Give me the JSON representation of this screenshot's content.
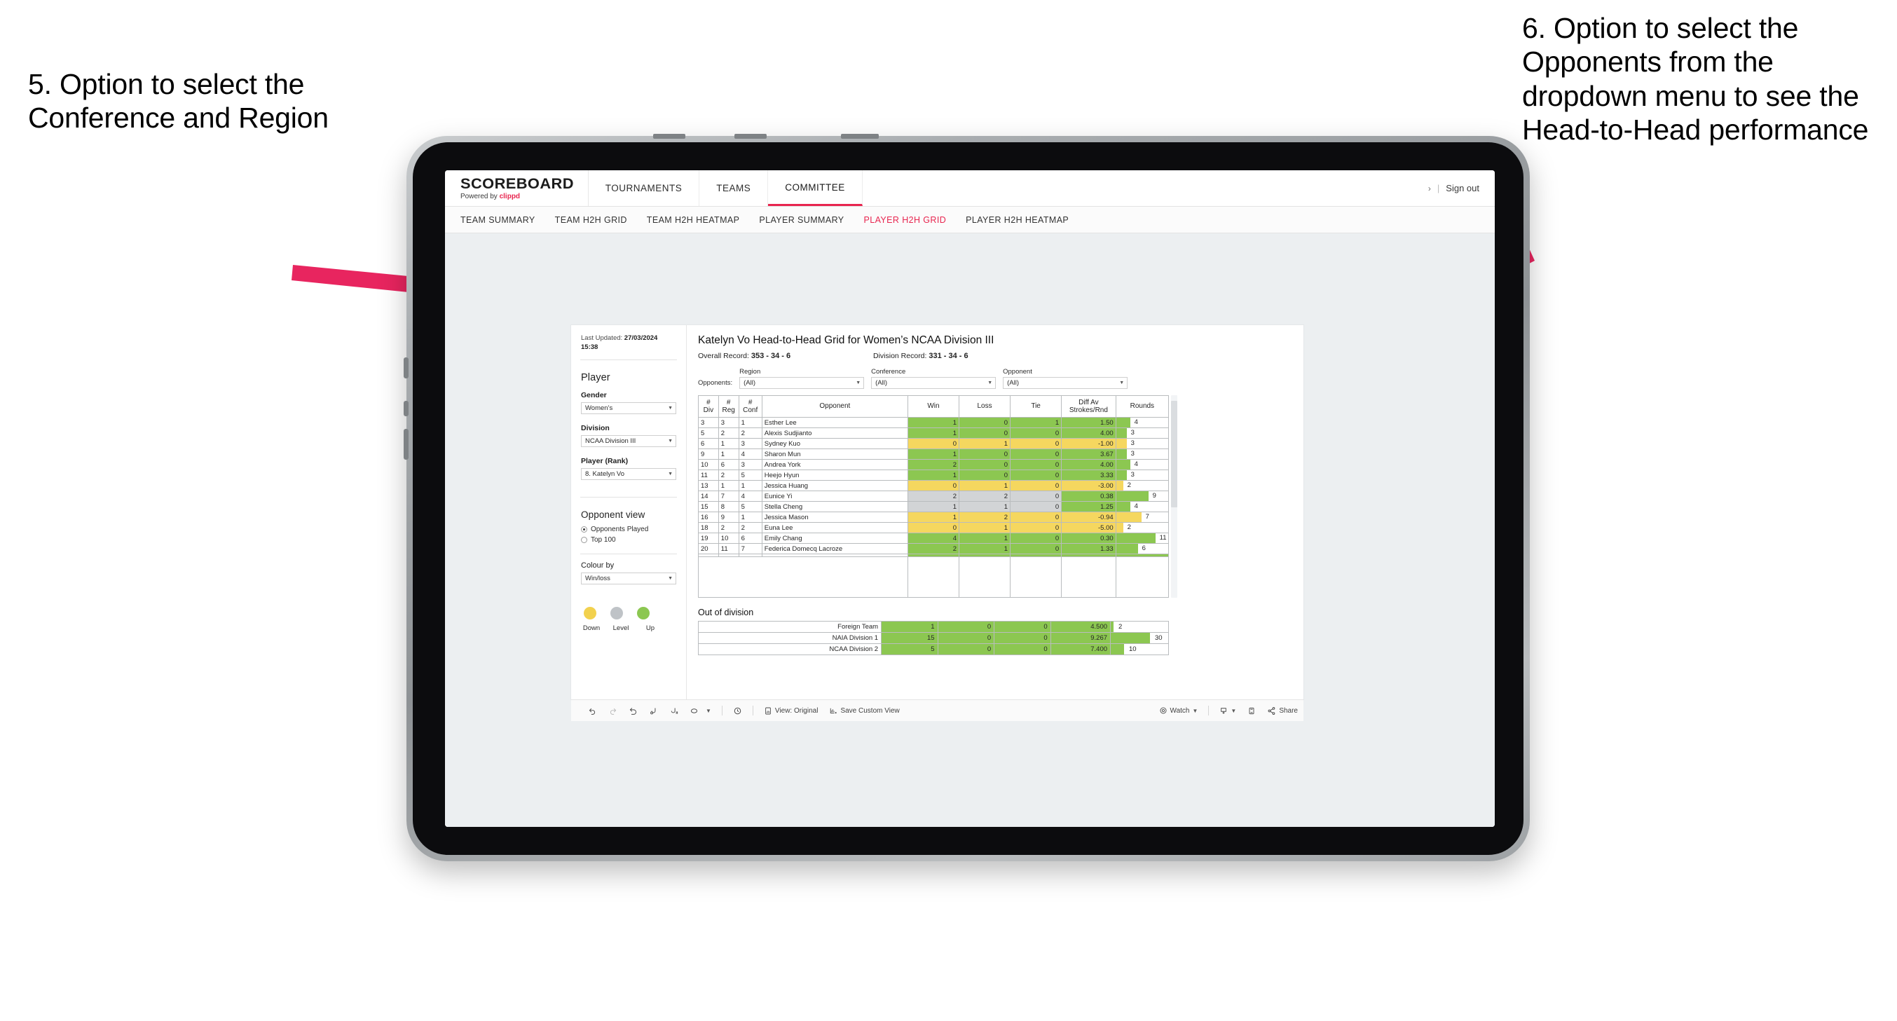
{
  "annotations": {
    "left": "5. Option to select the Conference and Region",
    "right": "6. Option to select the Opponents from the dropdown menu to see the Head-to-Head performance",
    "arrow_color": "#E8255F"
  },
  "app": {
    "brand": {
      "name": "SCOREBOARD",
      "powered_prefix": "Powered by ",
      "powered_brand": "clippd"
    },
    "top_nav": [
      {
        "label": "TOURNAMENTS",
        "active": false
      },
      {
        "label": "TEAMS",
        "active": false
      },
      {
        "label": "COMMITTEE",
        "active": true
      }
    ],
    "top_right": {
      "chevron": "›",
      "separator": "|",
      "sign_out": "Sign out"
    },
    "sub_nav": [
      {
        "label": "TEAM SUMMARY",
        "active": false
      },
      {
        "label": "TEAM H2H GRID",
        "active": false
      },
      {
        "label": "TEAM H2H HEATMAP",
        "active": false
      },
      {
        "label": "PLAYER SUMMARY",
        "active": false
      },
      {
        "label": "PLAYER H2H GRID",
        "active": true
      },
      {
        "label": "PLAYER H2H HEATMAP",
        "active": false
      }
    ]
  },
  "panel": {
    "last_updated_label": "Last Updated: ",
    "last_updated_value": "27/03/2024",
    "last_updated_time": "15:38",
    "player_heading": "Player",
    "fields": [
      {
        "label": "Gender",
        "value": "Women’s"
      },
      {
        "label": "Division",
        "value": "NCAA Division III"
      },
      {
        "label": "Player (Rank)",
        "value": "8. Katelyn Vo"
      }
    ],
    "opponent_view_heading": "Opponent view",
    "opponent_view_options": [
      {
        "label": "Opponents Played",
        "selected": true
      },
      {
        "label": "Top 100",
        "selected": false
      }
    ],
    "colour_by_label": "Colour by",
    "colour_by_value": "Win/loss",
    "legend": [
      {
        "label": "Down",
        "color": "#F2D14E"
      },
      {
        "label": "Level",
        "color": "#BFC3C7"
      },
      {
        "label": "Up",
        "color": "#8CC751"
      }
    ]
  },
  "report": {
    "title": "Katelyn Vo Head-to-Head Grid for Women’s NCAA Division III",
    "overall_record_label": "Overall Record: ",
    "overall_record_value": "353 - 34 - 6",
    "division_record_label": "Division Record: ",
    "division_record_value": "331 - 34 - 6",
    "opponents_label": "Opponents:",
    "filters": [
      {
        "caption": "Region",
        "value": "(All)"
      },
      {
        "caption": "Conference",
        "value": "(All)"
      },
      {
        "caption": "Opponent",
        "value": "(All)"
      }
    ],
    "out_of_division_title": "Out of division"
  },
  "chart_data": {
    "type": "table",
    "title": "Katelyn Vo Head-to-Head Grid for Women’s NCAA Division III",
    "columns": [
      "# Div",
      "# Reg",
      "# Conf",
      "Opponent",
      "Win",
      "Loss",
      "Tie",
      "Diff Av Strokes/Rnd",
      "Rounds"
    ],
    "column_header_lines": [
      [
        "#",
        "Div"
      ],
      [
        "#",
        "Reg"
      ],
      [
        "#",
        "Conf"
      ],
      [
        "Opponent"
      ],
      [
        "Win"
      ],
      [
        "Loss"
      ],
      [
        "Tie"
      ],
      [
        "Diff Av",
        "Strokes/Rnd"
      ],
      [
        "Rounds"
      ]
    ],
    "colour_scale": {
      "up": "#8CC751",
      "level": "#D2D4D6",
      "down": "#F5D75F"
    },
    "rounds_max": 11,
    "rows": [
      {
        "div": "3",
        "reg": "3",
        "conf": "1",
        "opponent": "Esther Lee",
        "win": "1",
        "loss": "0",
        "tie": "1",
        "diff": "1.50",
        "rounds": 4,
        "state": "up"
      },
      {
        "div": "5",
        "reg": "2",
        "conf": "2",
        "opponent": "Alexis Sudjianto",
        "win": "1",
        "loss": "0",
        "tie": "0",
        "diff": "4.00",
        "rounds": 3,
        "state": "up"
      },
      {
        "div": "6",
        "reg": "1",
        "conf": "3",
        "opponent": "Sydney Kuo",
        "win": "0",
        "loss": "1",
        "tie": "0",
        "diff": "-1.00",
        "rounds": 3,
        "state": "down"
      },
      {
        "div": "9",
        "reg": "1",
        "conf": "4",
        "opponent": "Sharon Mun",
        "win": "1",
        "loss": "0",
        "tie": "0",
        "diff": "3.67",
        "rounds": 3,
        "state": "up"
      },
      {
        "div": "10",
        "reg": "6",
        "conf": "3",
        "opponent": "Andrea York",
        "win": "2",
        "loss": "0",
        "tie": "0",
        "diff": "4.00",
        "rounds": 4,
        "state": "up"
      },
      {
        "div": "11",
        "reg": "2",
        "conf": "5",
        "opponent": "Heejo Hyun",
        "win": "1",
        "loss": "0",
        "tie": "0",
        "diff": "3.33",
        "rounds": 3,
        "state": "up"
      },
      {
        "div": "13",
        "reg": "1",
        "conf": "1",
        "opponent": "Jessica Huang",
        "win": "0",
        "loss": "1",
        "tie": "0",
        "diff": "-3.00",
        "rounds": 2,
        "state": "down"
      },
      {
        "div": "14",
        "reg": "7",
        "conf": "4",
        "opponent": "Eunice Yi",
        "win": "2",
        "loss": "2",
        "tie": "0",
        "diff": "0.38",
        "rounds": 9,
        "state": "level",
        "diff_state": "up"
      },
      {
        "div": "15",
        "reg": "8",
        "conf": "5",
        "opponent": "Stella Cheng",
        "win": "1",
        "loss": "1",
        "tie": "0",
        "diff": "1.25",
        "rounds": 4,
        "state": "level",
        "diff_state": "up"
      },
      {
        "div": "16",
        "reg": "9",
        "conf": "1",
        "opponent": "Jessica Mason",
        "win": "1",
        "loss": "2",
        "tie": "0",
        "diff": "-0.94",
        "rounds": 7,
        "state": "down"
      },
      {
        "div": "18",
        "reg": "2",
        "conf": "2",
        "opponent": "Euna Lee",
        "win": "0",
        "loss": "1",
        "tie": "0",
        "diff": "-5.00",
        "rounds": 2,
        "state": "down"
      },
      {
        "div": "19",
        "reg": "10",
        "conf": "6",
        "opponent": "Emily Chang",
        "win": "4",
        "loss": "1",
        "tie": "0",
        "diff": "0.30",
        "rounds": 11,
        "state": "up"
      },
      {
        "div": "20",
        "reg": "11",
        "conf": "7",
        "opponent": "Federica Domecq Lacroze",
        "win": "2",
        "loss": "1",
        "tie": "0",
        "diff": "1.33",
        "rounds": 6,
        "state": "up"
      }
    ],
    "out_of_division": {
      "rounds_max": 30,
      "rows": [
        {
          "name": "Foreign Team",
          "win": "1",
          "loss": "0",
          "tie": "0",
          "diff": "4.500",
          "rounds": 2,
          "state": "up"
        },
        {
          "name": "NAIA Division 1",
          "win": "15",
          "loss": "0",
          "tie": "0",
          "diff": "9.267",
          "rounds": 30,
          "state": "up"
        },
        {
          "name": "NCAA Division 2",
          "win": "5",
          "loss": "0",
          "tie": "0",
          "diff": "7.400",
          "rounds": 10,
          "state": "up"
        }
      ]
    }
  },
  "toolbar": {
    "items": [
      {
        "name": "undo-icon",
        "label": ""
      },
      {
        "name": "redo-icon",
        "label": ""
      },
      {
        "name": "revert-icon",
        "label": ""
      },
      {
        "name": "refresh-icon",
        "label": ""
      },
      {
        "name": "pause-icon",
        "label": ""
      },
      {
        "name": "highlight-icon",
        "label": ""
      },
      {
        "name": "caret-icon",
        "label": ""
      },
      {
        "name": "clock-icon",
        "label": ""
      },
      {
        "name": "view-original",
        "label": "View: Original"
      },
      {
        "name": "save-custom-view",
        "label": "Save Custom View"
      },
      {
        "name": "watch",
        "label": "Watch"
      },
      {
        "name": "download-icon",
        "label": ""
      },
      {
        "name": "fullscreen-icon",
        "label": ""
      },
      {
        "name": "share",
        "label": "Share"
      }
    ]
  }
}
